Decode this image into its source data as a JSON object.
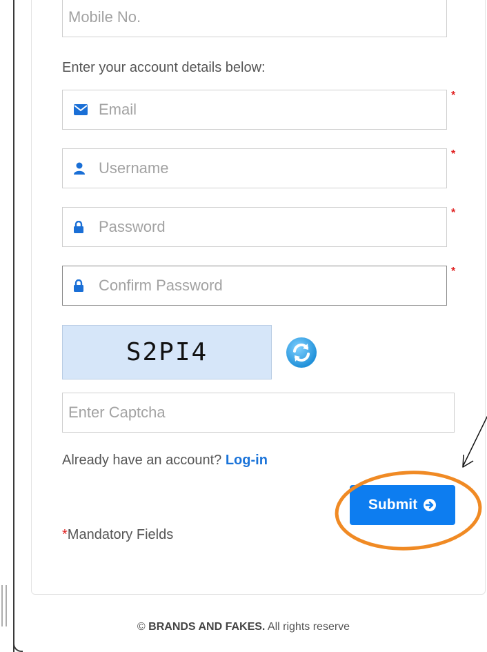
{
  "form": {
    "mobile_placeholder": "Mobile No.",
    "account_label": "Enter your account details below:",
    "email_placeholder": "Email",
    "username_placeholder": "Username",
    "password_placeholder": "Password",
    "confirm_placeholder": "Confirm Password",
    "required_mark": "*"
  },
  "captcha": {
    "code": "S2PI4",
    "input_placeholder": "Enter Captcha",
    "refresh_icon": "refresh-icon"
  },
  "account": {
    "prompt": "Already have an account?",
    "login_link": "Log-in"
  },
  "submit": {
    "label": "Submit",
    "icon": "arrow-right-circle-icon"
  },
  "mandatory": {
    "star": "*",
    "text": "Mandatory Fields"
  },
  "footer": {
    "copyright": "©",
    "brand": "BRANDS AND FAKES.",
    "rights": "All rights reserve"
  },
  "colors": {
    "accent": "#0d7df0",
    "link": "#1a73d9",
    "required": "#e02020",
    "captcha_bg": "#d6e6f9",
    "annotation": "#f08a24"
  }
}
